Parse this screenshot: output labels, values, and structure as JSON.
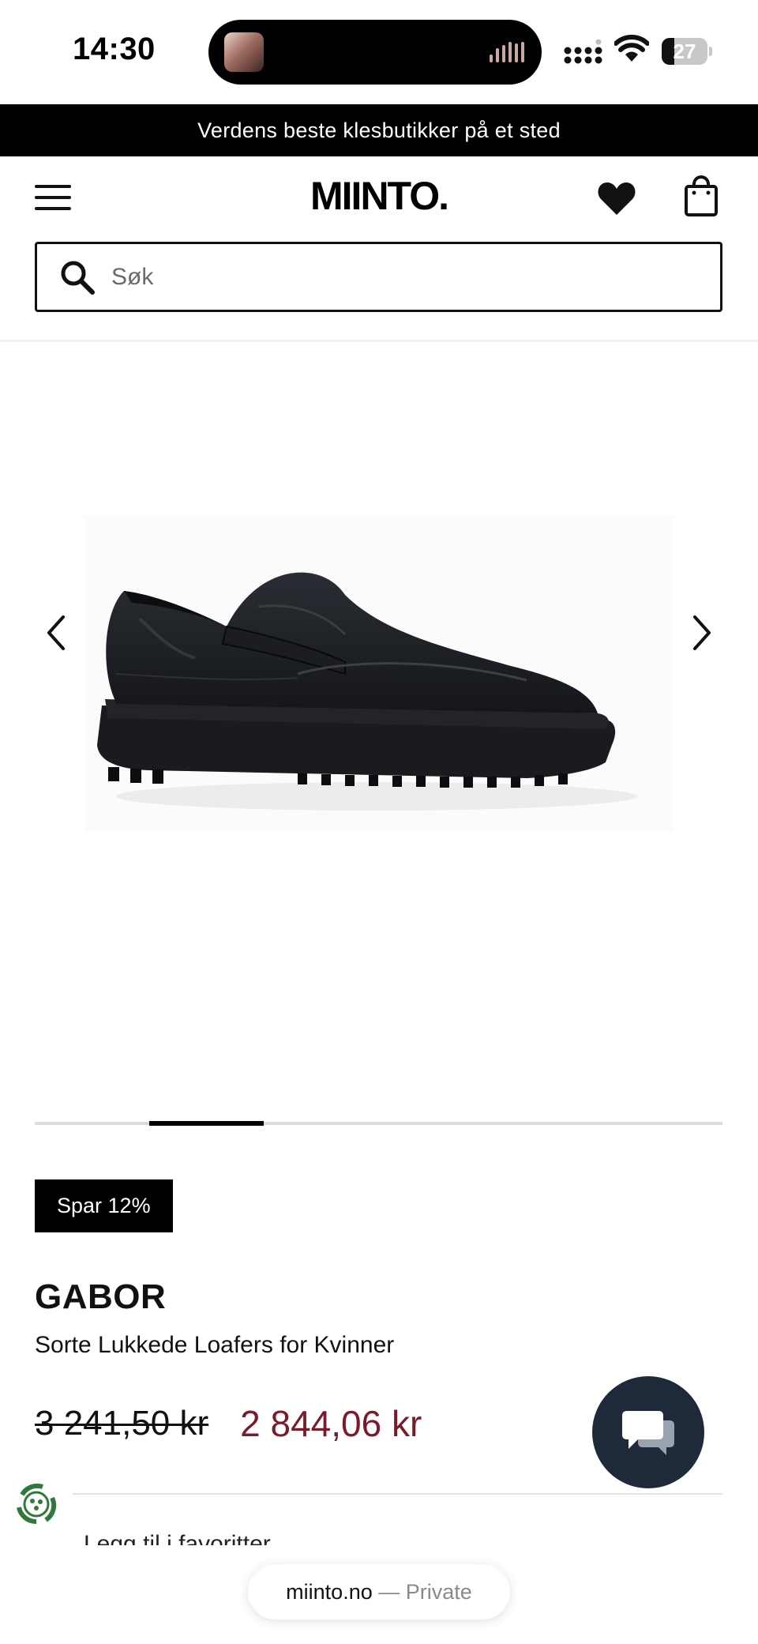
{
  "status_bar": {
    "time": "14:30",
    "battery_level": "27",
    "battery_fraction": 0.27
  },
  "promo": {
    "text": "Verdens beste klesbutikker på et sted"
  },
  "header": {
    "logo": "MIINTO.",
    "icons": {
      "menu": "hamburger-menu-icon",
      "wishlist": "heart-icon",
      "cart": "shopping-bag-icon"
    }
  },
  "search": {
    "placeholder": "Søk",
    "value": ""
  },
  "gallery": {
    "image_count": 6,
    "current_index": 1
  },
  "product": {
    "badge": "Spar 12%",
    "brand": "GABOR",
    "name": "Sorte Lukkede Loafers for Kvinner",
    "old_price": "3 241,50 kr",
    "sale_price": "2 844,06 kr",
    "favorite_link": "Legg til i favoritter"
  },
  "browser": {
    "host": "miinto.no",
    "separator": "—",
    "mode": "Private"
  },
  "colors": {
    "sale_price": "#7a1a2a",
    "chat_button": "#1e2a3a",
    "eco_icon": "#2f7a3a"
  }
}
